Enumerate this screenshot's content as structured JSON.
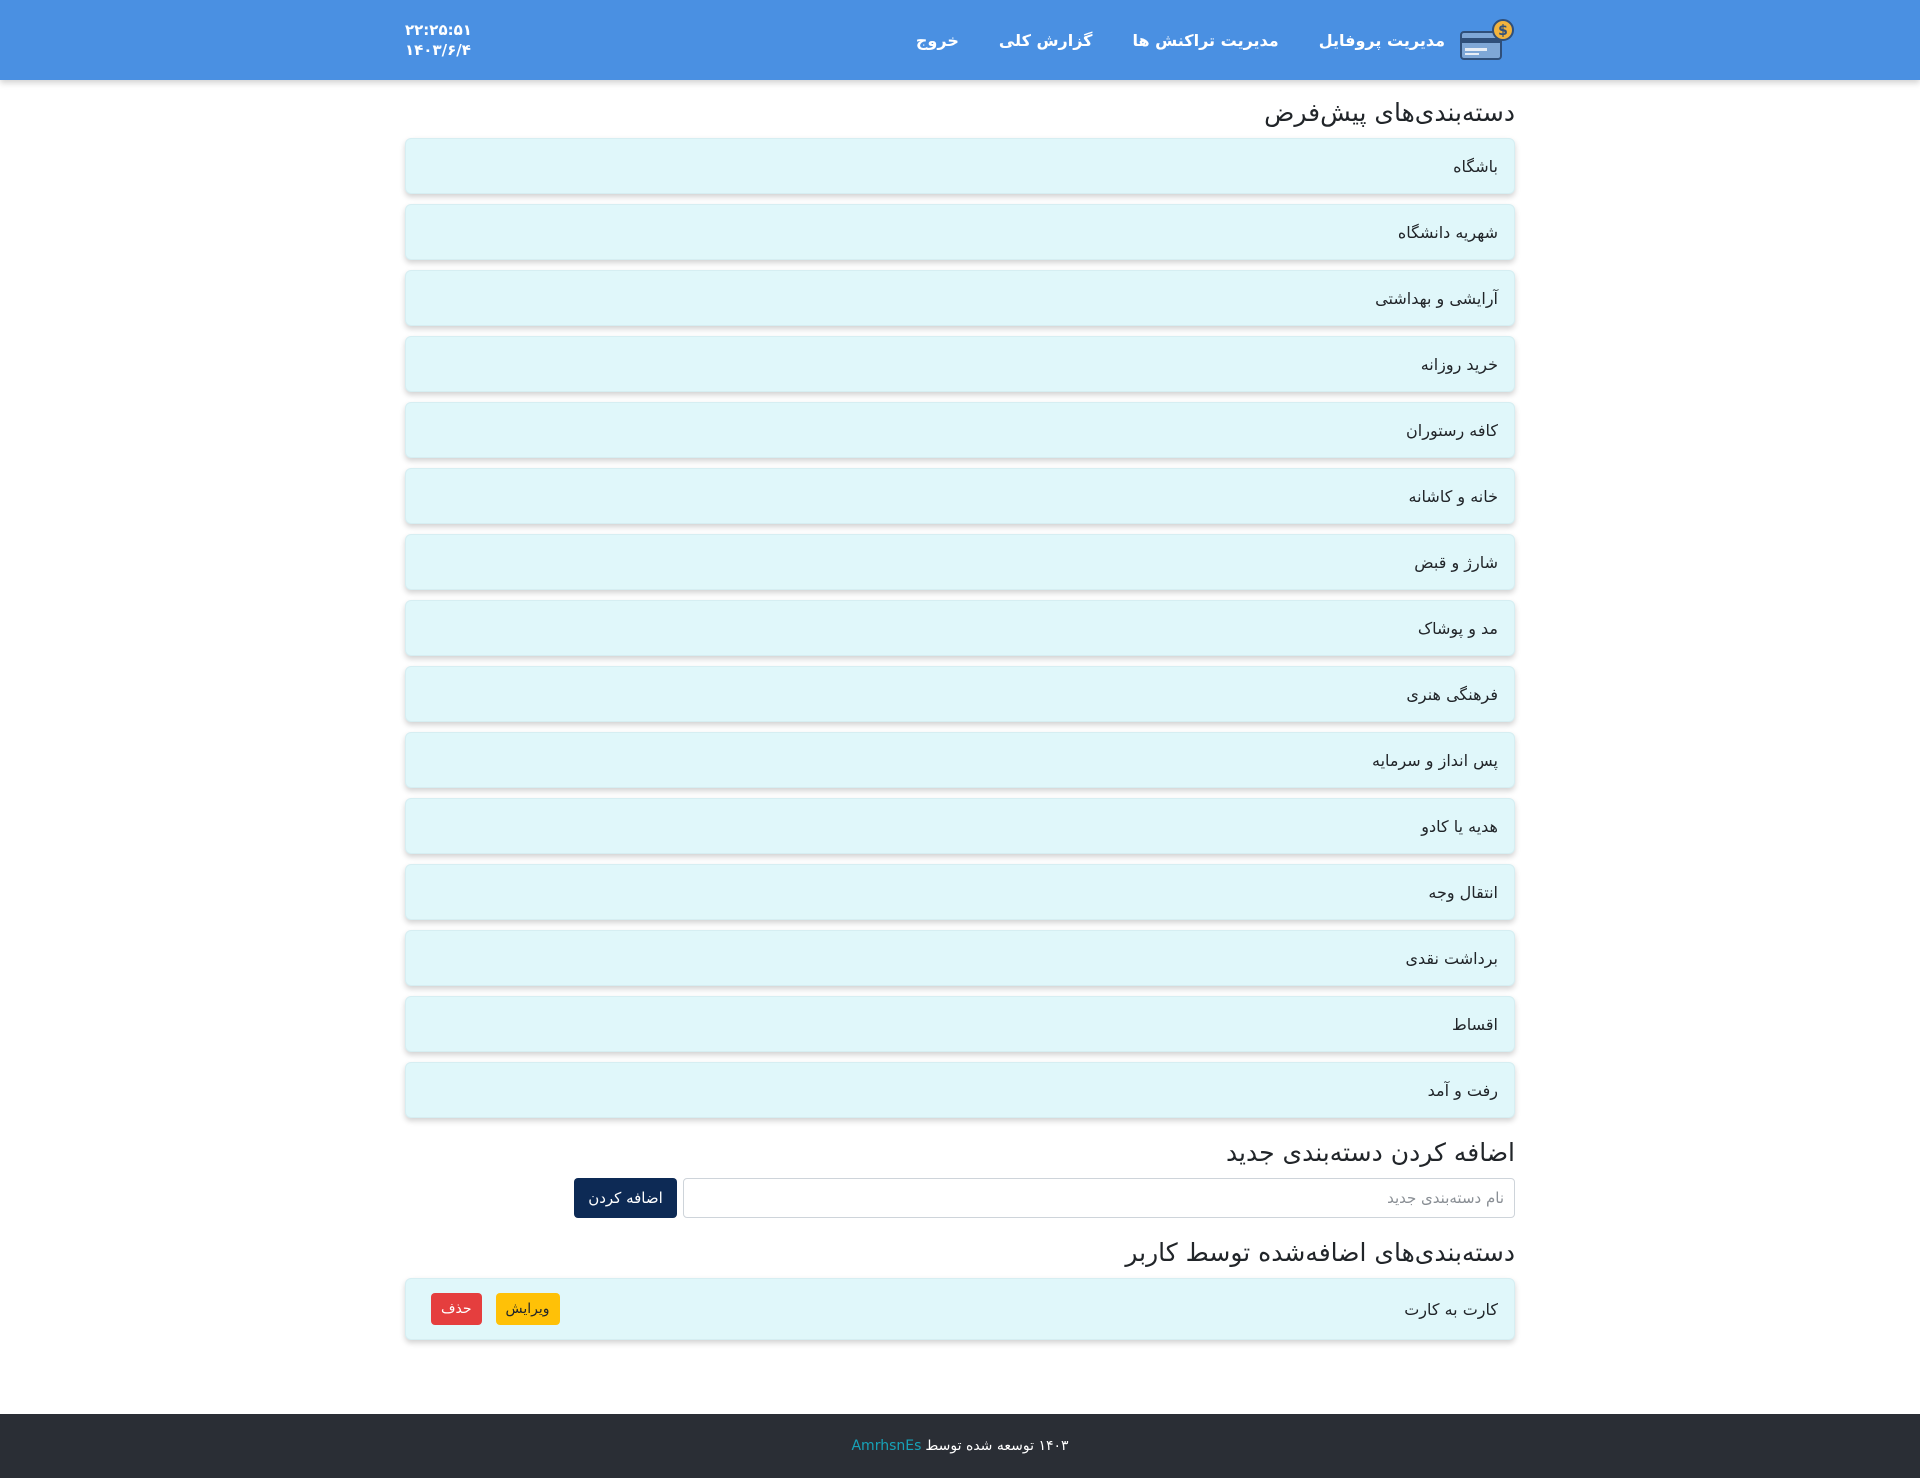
{
  "header": {
    "nav": {
      "profile": "مدیریت پروفایل",
      "transactions": "مدیریت تراکنش ها",
      "report": "گزارش کلی",
      "logout": "خروج"
    },
    "time": "۲۲:۲۵:۵۱",
    "date": "۱۴۰۳/۶/۴"
  },
  "default_categories": {
    "title": "دسته‌بندی‌های پیش‌فرض",
    "items": [
      "باشگاه",
      "شهریه دانشگاه",
      "آرایشی و بهداشتی",
      "خرید روزانه",
      "کافه رستوران",
      "خانه و کاشانه",
      "شارژ و قبض",
      "مد و پوشاک",
      "فرهنگی هنری",
      "پس انداز و سرمایه",
      "هدیه یا کادو",
      "انتقال وجه",
      "برداشت نقدی",
      "اقساط",
      "رفت و آمد"
    ]
  },
  "add_category": {
    "title": "اضافه کردن دسته‌بندی جدید",
    "placeholder": "نام دسته‌بندی جدید",
    "value": "",
    "button": "اضافه کردن"
  },
  "user_categories": {
    "title": "دسته‌بندی‌های اضافه‌شده توسط کاربر",
    "items": [
      {
        "name": "کارت به کارت",
        "edit": "ویرایش",
        "delete": "حذف"
      }
    ]
  },
  "footer": {
    "text": "۱۴۰۳ توسعه شده توسط",
    "author": "AmrhsnEs"
  },
  "colors": {
    "navbar": "#4a90e2",
    "item_bg": "#e0f7fa",
    "add_button": "#0d2a55",
    "edit_button": "#ffc107",
    "delete_button": "#e53e3e",
    "footer": "#2a2e35",
    "footer_link": "#17a2b8"
  },
  "icons": {
    "logo": "wallet-dollar-icon"
  }
}
